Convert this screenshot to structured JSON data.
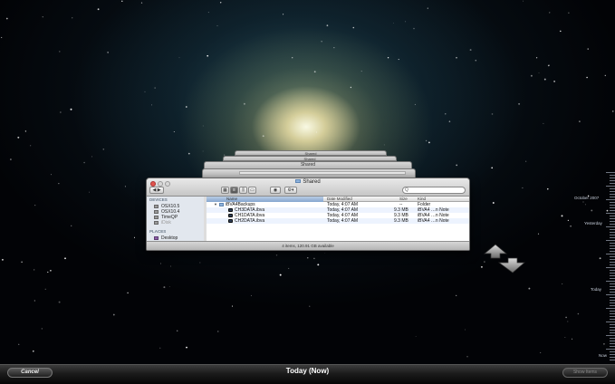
{
  "window": {
    "title": "Shared",
    "search_placeholder": "Q",
    "status": "4 items, 120.91 GB available"
  },
  "sidebar": {
    "devices_header": "DEVICES",
    "devices": [
      "OSX10.5",
      "OSX10.4",
      "TimeQP",
      "iDisk"
    ],
    "places_header": "PLACES",
    "places": [
      "Desktop"
    ]
  },
  "list": {
    "columns": [
      "Name",
      "Date Modified",
      "Size",
      "Kind"
    ],
    "rows": [
      {
        "name": "iBVA4Backups",
        "date": "Today, 4:07 AM",
        "size": "--",
        "kind": "Folder"
      },
      {
        "name": "CH3DATA.ibva",
        "date": "Today, 4:07 AM",
        "size": "9.3 MB",
        "kind": "iBVA4 …n Note"
      },
      {
        "name": "CH1DATA.ibva",
        "date": "Today, 4:07 AM",
        "size": "9.3 MB",
        "kind": "iBVA4 …n Note"
      },
      {
        "name": "CH2DATA.ibva",
        "date": "Today, 4:07 AM",
        "size": "9.3 MB",
        "kind": "iBVA4 …n Note"
      }
    ]
  },
  "stack": {
    "title": "Shared"
  },
  "timeline": {
    "labels": [
      "October 2007",
      "Yesterday",
      "Today",
      "Now"
    ]
  },
  "bottom_bar": {
    "cancel_label": "Cancel",
    "now_label": "Today (Now)",
    "restore_label": "Show Items"
  },
  "colors": {
    "close_button": "#e2544d",
    "selection_highlight": "#86a6cf"
  },
  "icons": {
    "nav_up": "arrow-up-icon",
    "nav_down": "arrow-down-icon"
  }
}
